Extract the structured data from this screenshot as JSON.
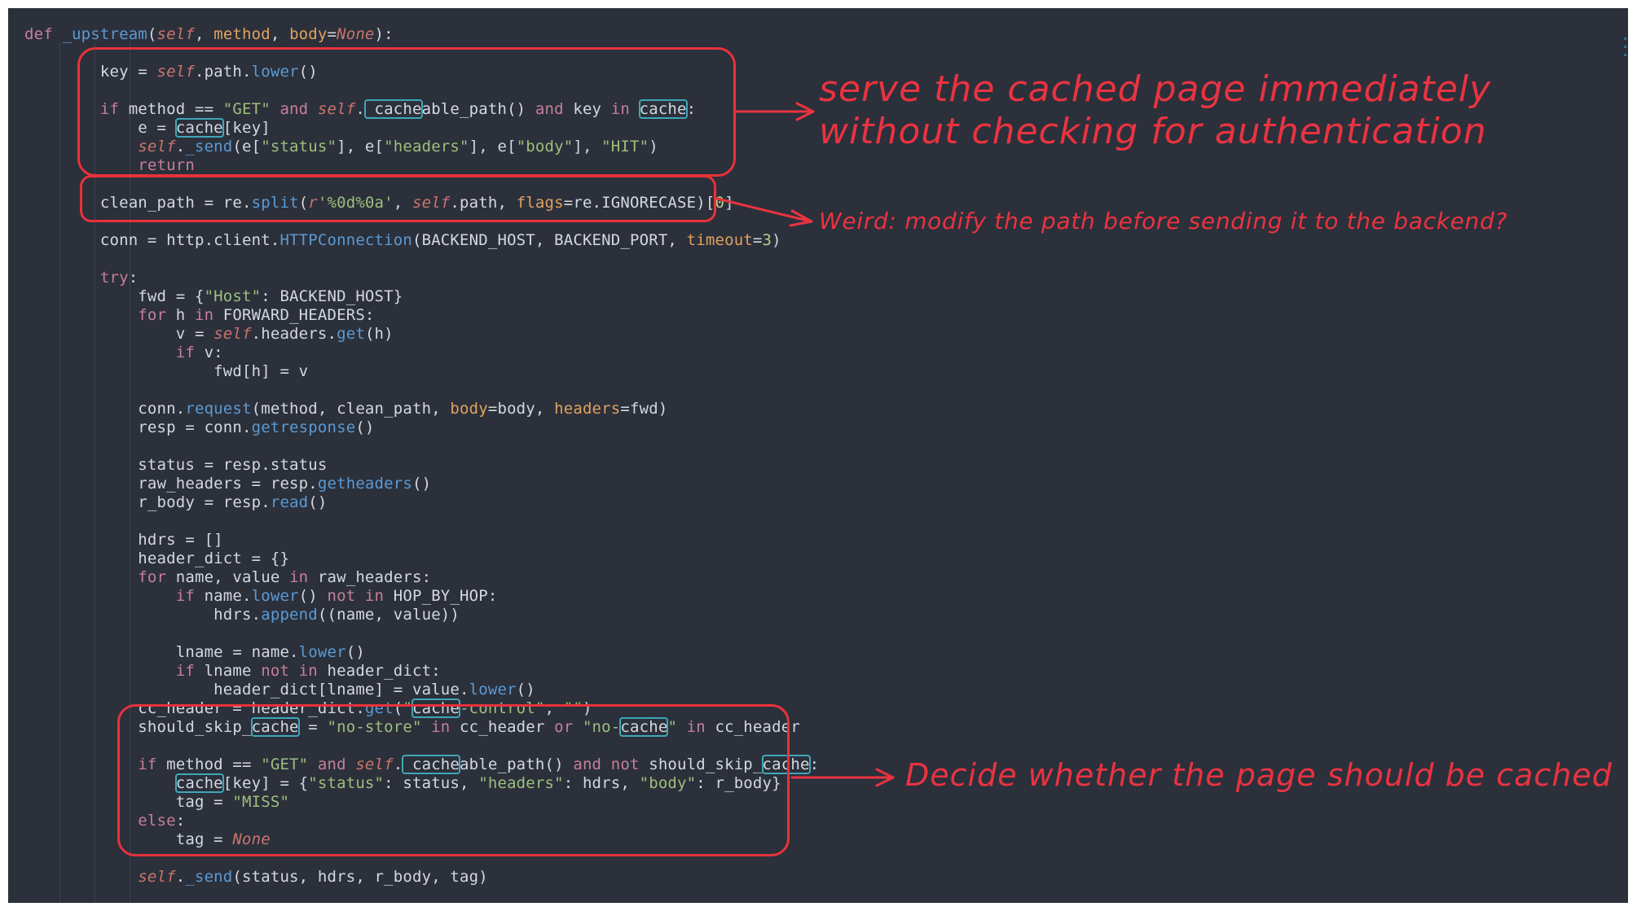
{
  "code": [
    [
      [
        "kw",
        "def "
      ],
      [
        "fn",
        "_upstream"
      ],
      [
        "t",
        "("
      ],
      [
        "it",
        "self"
      ],
      [
        "t",
        ", "
      ],
      [
        "pm",
        "method"
      ],
      [
        "t",
        ", "
      ],
      [
        "pm",
        "body"
      ],
      [
        "t",
        "="
      ],
      [
        "it",
        "None"
      ],
      [
        "t",
        "):"
      ]
    ],
    [],
    [
      [
        "t",
        "        key = "
      ],
      [
        "it",
        "self"
      ],
      [
        "t",
        ".path."
      ],
      [
        "fn",
        "lower"
      ],
      [
        "t",
        "()"
      ]
    ],
    [],
    [
      [
        "t",
        "        "
      ],
      [
        "kw",
        "if "
      ],
      [
        "t",
        "method == "
      ],
      [
        "st",
        "\"GET\""
      ],
      [
        "kw",
        " and "
      ],
      [
        "it",
        "self"
      ],
      [
        "t",
        "."
      ],
      [
        "hl",
        "_cache"
      ],
      [
        "t",
        "able_path() "
      ],
      [
        "kw",
        "and "
      ],
      [
        "t",
        "key "
      ],
      [
        "kw",
        "in "
      ],
      [
        "hl",
        "cache"
      ],
      [
        "t",
        ":"
      ]
    ],
    [
      [
        "t",
        "            e = "
      ],
      [
        "hl",
        "cache"
      ],
      [
        "t",
        "[key]"
      ]
    ],
    [
      [
        "t",
        "            "
      ],
      [
        "it",
        "self"
      ],
      [
        "t",
        "."
      ],
      [
        "fn",
        "_send"
      ],
      [
        "t",
        "(e["
      ],
      [
        "st",
        "\"status\""
      ],
      [
        "t",
        "], e["
      ],
      [
        "st",
        "\"headers\""
      ],
      [
        "t",
        "], e["
      ],
      [
        "st",
        "\"body\""
      ],
      [
        "t",
        "], "
      ],
      [
        "st",
        "\"HIT\""
      ],
      [
        "t",
        ")"
      ]
    ],
    [
      [
        "kw",
        "            return"
      ]
    ],
    [],
    [
      [
        "t",
        "        clean_path = re."
      ],
      [
        "fn",
        "split"
      ],
      [
        "t",
        "("
      ],
      [
        "it",
        "r"
      ],
      [
        "st",
        "'%0d%0a'"
      ],
      [
        "t",
        ", "
      ],
      [
        "it",
        "self"
      ],
      [
        "t",
        ".path, "
      ],
      [
        "pm",
        "flags"
      ],
      [
        "t",
        "=re.IGNORECASE)["
      ],
      [
        "nb",
        "0"
      ],
      [
        "t",
        "]"
      ]
    ],
    [],
    [
      [
        "t",
        "        conn = http.client."
      ],
      [
        "fn",
        "HTTPConnection"
      ],
      [
        "t",
        "(BACKEND_HOST, BACKEND_PORT, "
      ],
      [
        "pm",
        "timeout"
      ],
      [
        "t",
        "="
      ],
      [
        "nb",
        "3"
      ],
      [
        "t",
        ")"
      ]
    ],
    [],
    [
      [
        "kw",
        "        try"
      ],
      [
        "t",
        ":"
      ]
    ],
    [
      [
        "t",
        "            fwd = {"
      ],
      [
        "st",
        "\"Host\""
      ],
      [
        "t",
        ": BACKEND_HOST}"
      ]
    ],
    [
      [
        "kw",
        "            for "
      ],
      [
        "t",
        "h "
      ],
      [
        "kw",
        "in "
      ],
      [
        "t",
        "FORWARD_HEADERS:"
      ]
    ],
    [
      [
        "t",
        "                v = "
      ],
      [
        "it",
        "self"
      ],
      [
        "t",
        ".headers."
      ],
      [
        "fn",
        "get"
      ],
      [
        "t",
        "(h)"
      ]
    ],
    [
      [
        "kw",
        "                if "
      ],
      [
        "t",
        "v:"
      ]
    ],
    [
      [
        "t",
        "                    fwd[h] = v"
      ]
    ],
    [],
    [
      [
        "t",
        "            conn."
      ],
      [
        "fn",
        "request"
      ],
      [
        "t",
        "(method, clean_path, "
      ],
      [
        "pm",
        "body"
      ],
      [
        "t",
        "=body, "
      ],
      [
        "pm",
        "headers"
      ],
      [
        "t",
        "=fwd)"
      ]
    ],
    [
      [
        "t",
        "            resp = conn."
      ],
      [
        "fn",
        "getresponse"
      ],
      [
        "t",
        "()"
      ]
    ],
    [],
    [
      [
        "t",
        "            status = resp.status"
      ]
    ],
    [
      [
        "t",
        "            raw_headers = resp."
      ],
      [
        "fn",
        "getheaders"
      ],
      [
        "t",
        "()"
      ]
    ],
    [
      [
        "t",
        "            r_body = resp."
      ],
      [
        "fn",
        "read"
      ],
      [
        "t",
        "()"
      ]
    ],
    [],
    [
      [
        "t",
        "            hdrs = []"
      ]
    ],
    [
      [
        "t",
        "            header_dict = {}"
      ]
    ],
    [
      [
        "kw",
        "            for "
      ],
      [
        "t",
        "name, value "
      ],
      [
        "kw",
        "in "
      ],
      [
        "t",
        "raw_headers:"
      ]
    ],
    [
      [
        "kw",
        "                if "
      ],
      [
        "t",
        "name."
      ],
      [
        "fn",
        "lower"
      ],
      [
        "t",
        "() "
      ],
      [
        "kw",
        "not in "
      ],
      [
        "t",
        "HOP_BY_HOP:"
      ]
    ],
    [
      [
        "t",
        "                    hdrs."
      ],
      [
        "fn",
        "append"
      ],
      [
        "t",
        "((name, value))"
      ]
    ],
    [],
    [
      [
        "t",
        "                lname = name."
      ],
      [
        "fn",
        "lower"
      ],
      [
        "t",
        "()"
      ]
    ],
    [
      [
        "kw",
        "                if "
      ],
      [
        "t",
        "lname "
      ],
      [
        "kw",
        "not in "
      ],
      [
        "t",
        "header_dict:"
      ]
    ],
    [
      [
        "t",
        "                    header_dict[lname] = value."
      ],
      [
        "fn",
        "lower"
      ],
      [
        "t",
        "()"
      ]
    ],
    [
      [
        "t",
        "            cc_header = header_dict."
      ],
      [
        "fn",
        "get"
      ],
      [
        "t",
        "("
      ],
      [
        "st",
        "\""
      ],
      [
        "hl",
        "cache"
      ],
      [
        "st",
        "-control\""
      ],
      [
        "t",
        ", "
      ],
      [
        "st",
        "\"\""
      ],
      [
        "t",
        ")"
      ]
    ],
    [
      [
        "t",
        "            should_skip_"
      ],
      [
        "hl",
        "cache"
      ],
      [
        "t",
        " = "
      ],
      [
        "st",
        "\"no-store\""
      ],
      [
        "kw",
        " in "
      ],
      [
        "t",
        "cc_header "
      ],
      [
        "kw",
        "or "
      ],
      [
        "st",
        "\"no-"
      ],
      [
        "hl",
        "cache"
      ],
      [
        "st",
        "\""
      ],
      [
        "kw",
        " in "
      ],
      [
        "t",
        "cc_header"
      ]
    ],
    [],
    [
      [
        "t",
        "            "
      ],
      [
        "kw",
        "if "
      ],
      [
        "t",
        "method == "
      ],
      [
        "st",
        "\"GET\""
      ],
      [
        "kw",
        " and "
      ],
      [
        "it",
        "self"
      ],
      [
        "t",
        "."
      ],
      [
        "hl",
        "_cache"
      ],
      [
        "t",
        "able_path() "
      ],
      [
        "kw",
        "and not "
      ],
      [
        "t",
        "should_skip_"
      ],
      [
        "hl",
        "cache"
      ],
      [
        "t",
        ":"
      ]
    ],
    [
      [
        "t",
        "                "
      ],
      [
        "hl",
        "cache"
      ],
      [
        "t",
        "[key] = {"
      ],
      [
        "st",
        "\"status\""
      ],
      [
        "t",
        ": status, "
      ],
      [
        "st",
        "\"headers\""
      ],
      [
        "t",
        ": hdrs, "
      ],
      [
        "st",
        "\"body\""
      ],
      [
        "t",
        ": r_body}"
      ]
    ],
    [
      [
        "t",
        "                tag = "
      ],
      [
        "st",
        "\"MISS\""
      ]
    ],
    [
      [
        "kw",
        "            else"
      ],
      [
        "t",
        ":"
      ]
    ],
    [
      [
        "t",
        "                tag = "
      ],
      [
        "it",
        "None"
      ]
    ],
    [],
    [
      [
        "t",
        "            "
      ],
      [
        "it",
        "self"
      ],
      [
        "t",
        "."
      ],
      [
        "fn",
        "_send"
      ],
      [
        "t",
        "(status, hdrs, r_body, tag)"
      ]
    ]
  ],
  "annotations": {
    "a1_line1": "serve the cached page immediately",
    "a1_line2": "without checking for authentication",
    "a2": "Weird: modify the path before sending it to the backend?",
    "a3": "Decide whether the page should be cached"
  },
  "colors": {
    "background": "#2b303b",
    "annotation_red": "#ea3340",
    "keyword": "#c77f99",
    "string": "#9ebf7c",
    "function": "#5b9ad3",
    "parameter": "#e0a25e",
    "highlight_outline": "#3fa7b7"
  }
}
